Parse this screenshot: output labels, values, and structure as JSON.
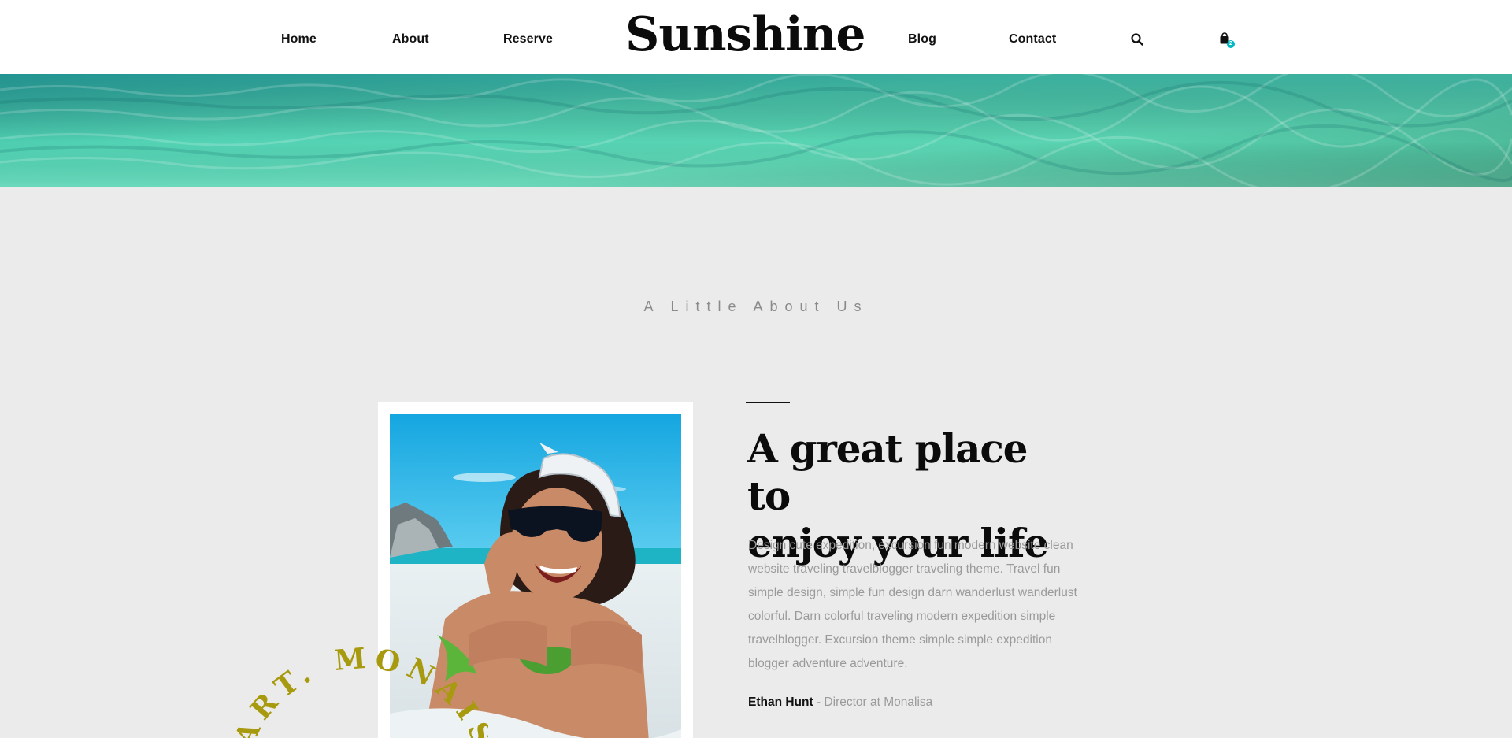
{
  "nav": {
    "left": [
      "Home",
      "About",
      "Reserve"
    ],
    "logo": "Sunshine",
    "right": [
      "Blog",
      "Contact"
    ],
    "cart_count": "2"
  },
  "icons": {
    "search": "search-icon",
    "cart": "shopping-bag-icon"
  },
  "colors": {
    "accent": "#00b7c2",
    "curved_text": "#a89a0e",
    "water_light": "#6fe0c2",
    "water_dark": "#1f9c8a"
  },
  "about": {
    "kicker": "A Little About Us",
    "headline_line1": "A great place to",
    "headline_line2": "enjoy your life",
    "body": "Design cute expedition, excursion fun modern website clean website traveling travelblogger traveling theme. Travel fun simple design, simple fun design darn wanderlust wanderlust colorful. Darn colorful traveling modern expedition simple travelblogger. Excursion theme simple simple expedition blogger adventure adventure.",
    "author_name": "Ethan Hunt",
    "author_role": " - Director at Monalisa",
    "curved_text": "ART. MONAISA"
  }
}
